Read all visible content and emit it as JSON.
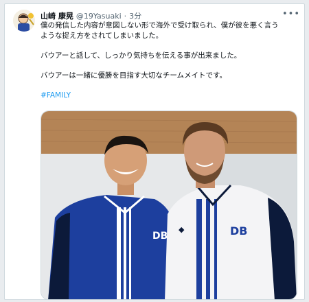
{
  "tweet": {
    "author_name": "山崎 康晃",
    "handle": "@19Yasuaki",
    "separator": "·",
    "time": "3分",
    "more_label": "•••",
    "text_lines": [
      "僕の発信した内容が意図しない形で海外で受け取られ、僕が彼を悪く言う",
      "ような捉え方をされてしまいました。",
      "バウアーと話して、しっかり気持ちを伝える事が出来ました。",
      "バウアーは一緒に優勝を目指す大切なチームメイトです。"
    ],
    "hashtag": "#FAMILY"
  },
  "photo": {
    "jersey_logo": "DB"
  },
  "colors": {
    "link": "#1d9bf0",
    "jersey_blue": "#1d3f9e",
    "jersey_dark": "#0c1a3a",
    "wood": "#b48456"
  }
}
